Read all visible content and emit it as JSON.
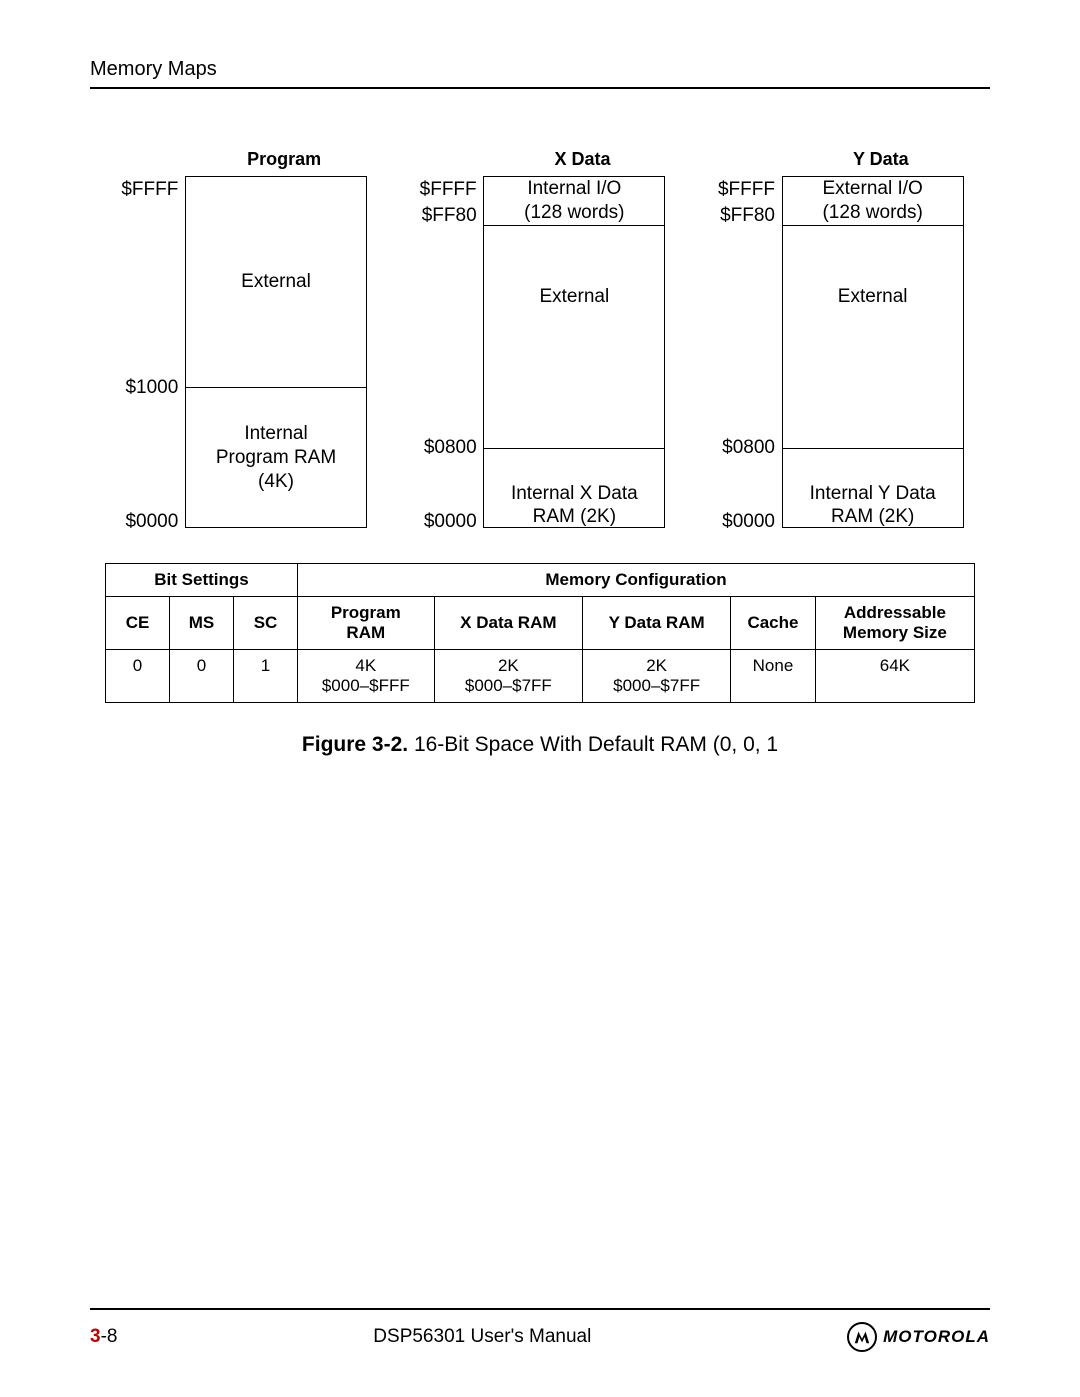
{
  "header": {
    "section": "Memory Maps"
  },
  "diagrams": {
    "program": {
      "title": "Program",
      "addrs": {
        "top": "$FFFF",
        "mid": "$1000",
        "bot": "$0000"
      },
      "ext": "External",
      "int1": "Internal",
      "int2": "Program RAM",
      "int3": "(4K)"
    },
    "xdata": {
      "title": "X Data",
      "addrs": {
        "top": "$FFFF",
        "io": "$FF80",
        "mid": "$0800",
        "bot": "$0000"
      },
      "io1": "Internal I/O",
      "io2": "(128 words)",
      "ext": "External",
      "int1": "Internal X Data",
      "int2": "RAM (2K)"
    },
    "ydata": {
      "title": "Y Data",
      "addrs": {
        "top": "$FFFF",
        "io": "$FF80",
        "mid": "$0800",
        "bot": "$0000"
      },
      "io1": "External I/O",
      "io2": "(128 words)",
      "ext": "External",
      "int1": "Internal Y Data",
      "int2": "RAM (2K)"
    }
  },
  "table": {
    "h_bit": "Bit Settings",
    "h_mem": "Memory Configuration",
    "h_ce": "CE",
    "h_ms": "MS",
    "h_sc": "SC",
    "h_pram1": "Program",
    "h_pram2": "RAM",
    "h_xram": "X Data RAM",
    "h_yram": "Y Data RAM",
    "h_cache": "Cache",
    "h_addr1": "Addressable",
    "h_addr2": "Memory Size",
    "r_ce": "0",
    "r_ms": "0",
    "r_sc": "1",
    "r_pram1": "4K",
    "r_pram2": "$000–$FFF",
    "r_xram1": "2K",
    "r_xram2": "$000–$7FF",
    "r_yram1": "2K",
    "r_yram2": "$000–$7FF",
    "r_cache": "None",
    "r_addr": "64K"
  },
  "caption": {
    "label": "Figure 3-2.",
    "text": " 16-Bit Space With Default RAM (0, 0, 1"
  },
  "footer": {
    "chapter": "3",
    "page": "-8",
    "manual": "DSP56301 User's Manual",
    "brand": "MOTOROLA"
  }
}
